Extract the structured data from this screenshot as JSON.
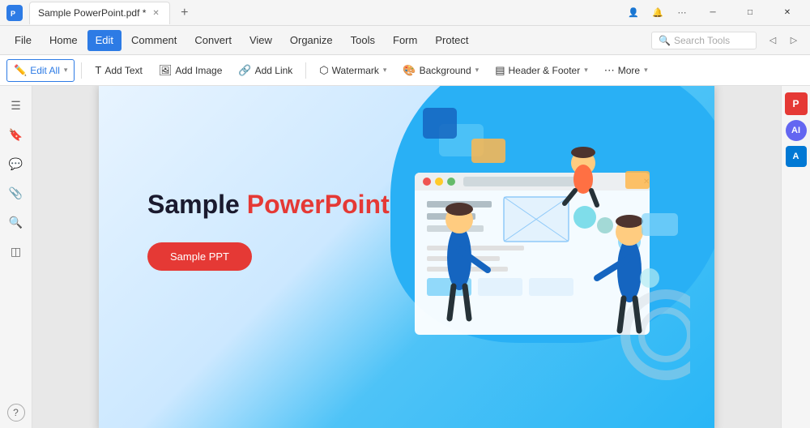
{
  "titlebar": {
    "tab_title": "Sample PowerPoint.pdf *",
    "add_tab_label": "+",
    "minimize_label": "─",
    "maximize_label": "□",
    "close_label": "✕",
    "avatar_icon": "👤"
  },
  "menubar": {
    "items": [
      {
        "label": "File",
        "active": false
      },
      {
        "label": "Home",
        "active": false
      },
      {
        "label": "Edit",
        "active": true
      },
      {
        "label": "Comment",
        "active": false
      },
      {
        "label": "Convert",
        "active": false
      },
      {
        "label": "View",
        "active": false
      },
      {
        "label": "Organize",
        "active": false
      },
      {
        "label": "Tools",
        "active": false
      },
      {
        "label": "Form",
        "active": false
      },
      {
        "label": "Protect",
        "active": false
      }
    ],
    "search_placeholder": "Search Tools"
  },
  "toolbar": {
    "edit_all_label": "Edit All",
    "add_text_label": "Add Text",
    "add_image_label": "Add Image",
    "add_link_label": "Add Link",
    "watermark_label": "Watermark",
    "background_label": "Background",
    "header_footer_label": "Header & Footer",
    "more_label": "More"
  },
  "left_sidebar": {
    "icons": [
      {
        "name": "pages-icon",
        "symbol": "☰"
      },
      {
        "name": "bookmark-icon",
        "symbol": "🔖"
      },
      {
        "name": "comment-icon",
        "symbol": "💬"
      },
      {
        "name": "attachment-icon",
        "symbol": "📎"
      },
      {
        "name": "search-icon",
        "symbol": "🔍"
      },
      {
        "name": "layers-icon",
        "symbol": "◫"
      }
    ],
    "bottom_icon": {
      "name": "help-icon",
      "symbol": "?"
    }
  },
  "right_sidebar": {
    "icons": [
      {
        "name": "pdf-icon",
        "symbol": "P",
        "style": "red"
      },
      {
        "name": "ai-icon",
        "symbol": "AI",
        "style": "ai"
      },
      {
        "name": "ms-icon",
        "symbol": "A",
        "style": "ms"
      }
    ]
  },
  "slide": {
    "title_black": "Sample",
    "title_red": "PowerPoint",
    "button_label": "Sample PPT",
    "illustration_alt": "PowerPoint illustration with people and UI elements"
  },
  "nav": {
    "back_icon": "◁",
    "forward_icon": "▷"
  }
}
